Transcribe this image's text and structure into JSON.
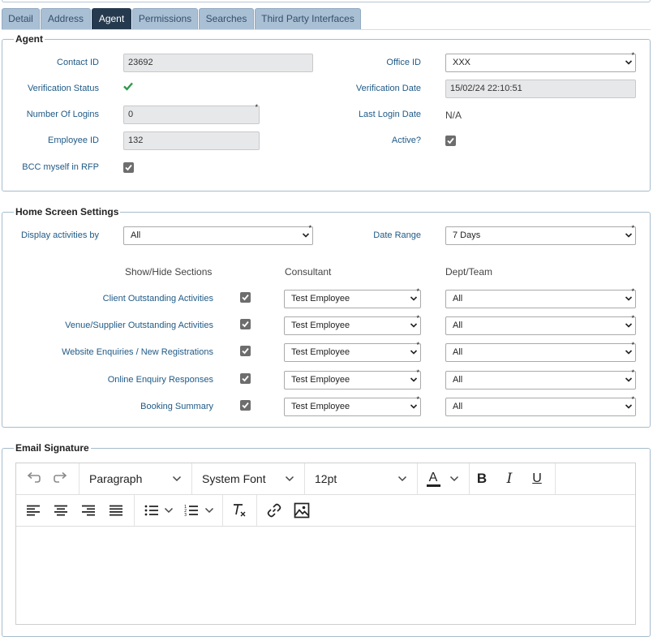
{
  "tabs": [
    {
      "label": "Detail",
      "active": false
    },
    {
      "label": "Address",
      "active": false
    },
    {
      "label": "Agent",
      "active": true
    },
    {
      "label": "Permissions",
      "active": false
    },
    {
      "label": "Searches",
      "active": false
    },
    {
      "label": "Third Party Interfaces",
      "active": false
    }
  ],
  "agent": {
    "legend": "Agent",
    "contact_id_label": "Contact ID",
    "contact_id_value": "23692",
    "office_id_label": "Office ID",
    "office_id_value": "XXX",
    "verification_status_label": "Verification Status",
    "verification_status_value": "verified",
    "verification_date_label": "Verification Date",
    "verification_date_value": "15/02/24 22:10:51",
    "logins_label": "Number Of Logins",
    "logins_value": "0",
    "last_login_label": "Last Login Date",
    "last_login_value": "N/A",
    "employee_id_label": "Employee ID",
    "employee_id_value": "132",
    "active_label": "Active?",
    "active_checked": true,
    "bcc_label": "BCC myself in RFP",
    "bcc_checked": true
  },
  "home": {
    "legend": "Home Screen Settings",
    "display_label": "Display activities by",
    "display_value": "All",
    "date_range_label": "Date Range",
    "date_range_value": "7 Days",
    "col_sections": "Show/Hide Sections",
    "col_consultant": "Consultant",
    "col_dept": "Dept/Team",
    "rows": [
      {
        "label": "Client Outstanding Activities",
        "checked": true,
        "consultant": "Test Employee",
        "dept": "All"
      },
      {
        "label": "Venue/Supplier Outstanding Activities",
        "checked": true,
        "consultant": "Test Employee",
        "dept": "All"
      },
      {
        "label": "Website Enquiries / New Registrations",
        "checked": true,
        "consultant": "Test Employee",
        "dept": "All"
      },
      {
        "label": "Online Enquiry Responses",
        "checked": true,
        "consultant": "Test Employee",
        "dept": "All"
      },
      {
        "label": "Booking Summary",
        "checked": true,
        "consultant": "Test Employee",
        "dept": "All"
      }
    ]
  },
  "signature": {
    "legend": "Email Signature",
    "block_format": "Paragraph",
    "font_family": "System Font",
    "font_size": "12pt",
    "text_color_letter": "A",
    "bold_letter": "B",
    "italic_letter": "I",
    "underline_letter": "U"
  },
  "colors": {
    "tab_bg": "#a9bfd4",
    "tab_active_bg": "#263a4f",
    "label_blue": "#1f5a86",
    "border": "#a6bccd",
    "check_green": "#2e9a4a"
  }
}
